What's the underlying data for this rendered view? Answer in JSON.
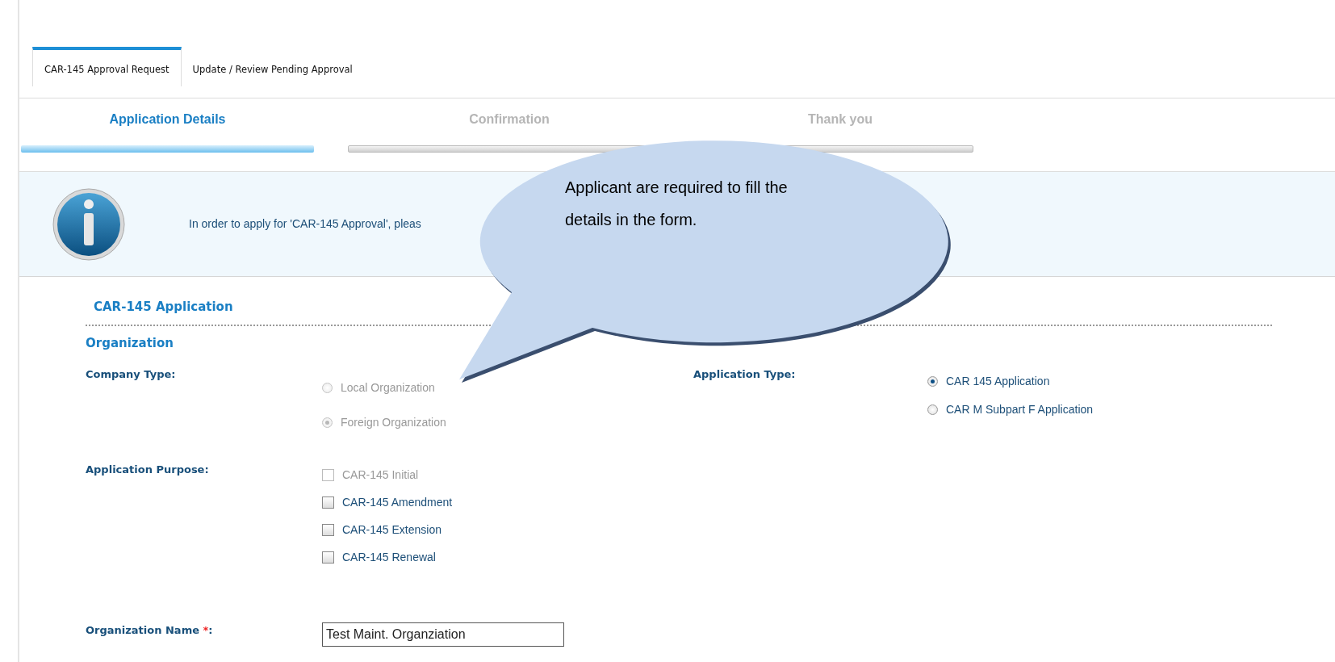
{
  "tabs": [
    {
      "label": "CAR-145 Approval Request",
      "selected": true
    },
    {
      "label": "Update / Review Pending Approval",
      "selected": false
    }
  ],
  "steps": [
    {
      "label": "Application Details",
      "selected": true
    },
    {
      "label": "Confirmation",
      "selected": false
    },
    {
      "label": "Thank you",
      "selected": false
    }
  ],
  "info_message": "In order to apply for 'CAR-145 Approval', pleas",
  "callout": "Applicant are required to fill the details in the form.",
  "section_title": "CAR-145 Application",
  "subsection_title": "Organization",
  "company_type": {
    "label": "Company Type:",
    "options": [
      {
        "label": "Local Organization",
        "selected": false,
        "disabled": true
      },
      {
        "label": "Foreign Organization",
        "selected": true,
        "disabled": true
      }
    ]
  },
  "application_type": {
    "label": "Application Type:",
    "options": [
      {
        "label": "CAR 145 Application",
        "selected": true,
        "disabled": false
      },
      {
        "label": "CAR M Subpart F Application",
        "selected": false,
        "disabled": false
      }
    ]
  },
  "application_purpose": {
    "label": "Application Purpose:",
    "options": [
      {
        "label": "CAR-145 Initial",
        "checked": false,
        "disabled": true
      },
      {
        "label": "CAR-145 Amendment",
        "checked": false,
        "disabled": false
      },
      {
        "label": "CAR-145 Extension",
        "checked": false,
        "disabled": false
      },
      {
        "label": "CAR-145 Renewal",
        "checked": false,
        "disabled": false
      }
    ]
  },
  "organization_name": {
    "label": "Organization Name",
    "required_mark": "*",
    "colon": ":",
    "value": "Test Maint. Organziation"
  }
}
